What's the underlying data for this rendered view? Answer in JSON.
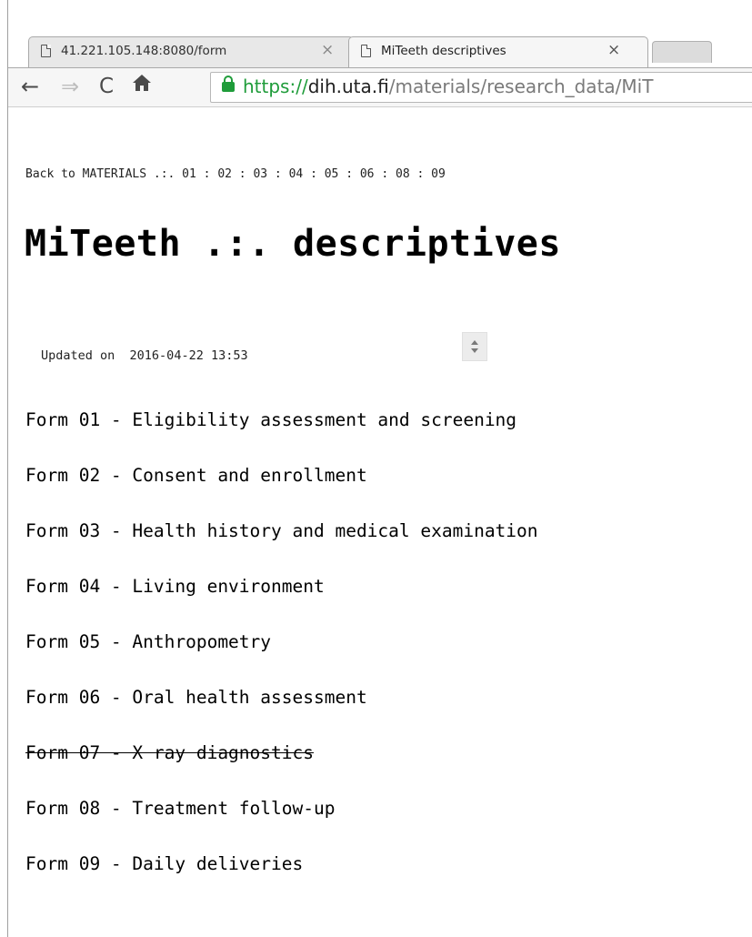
{
  "browser": {
    "tabs": [
      {
        "title": "41.221.105.148:8080/form",
        "active": false
      },
      {
        "title": "MiTeeth descriptives",
        "active": true
      }
    ],
    "close_glyph": "×",
    "nav": {
      "back": "←",
      "forward": "⇒",
      "reload": "C",
      "home": "🏠"
    },
    "url": {
      "scheme": "https://",
      "host": "dih.uta.fi",
      "path": "/materials/research_data/MiT"
    },
    "colors": {
      "secure": "#1f9c3a"
    }
  },
  "page": {
    "breadcrumb": "Back to MATERIALS .:. 01 : 02 : 03 : 04 : 05 : 06 : 08 : 09",
    "title": "MiTeeth .:. descriptives",
    "updated_label": "Updated on",
    "updated_value": "2016-04-22 13:53",
    "forms": [
      {
        "label": "Form 01 - Eligibility assessment and screening",
        "struck": false
      },
      {
        "label": "Form 02 - Consent and enrollment",
        "struck": false
      },
      {
        "label": "Form 03 - Health history and medical examination",
        "struck": false
      },
      {
        "label": "Form 04 - Living environment",
        "struck": false
      },
      {
        "label": "Form 05 - Anthropometry",
        "struck": false
      },
      {
        "label": "Form 06 - Oral health assessment",
        "struck": false
      },
      {
        "label": "Form 07 - X ray diagnostics",
        "struck": true
      },
      {
        "label": "Form 08 - Treatment follow-up",
        "struck": false
      },
      {
        "label": "Form 09 - Daily deliveries",
        "struck": false
      }
    ]
  }
}
